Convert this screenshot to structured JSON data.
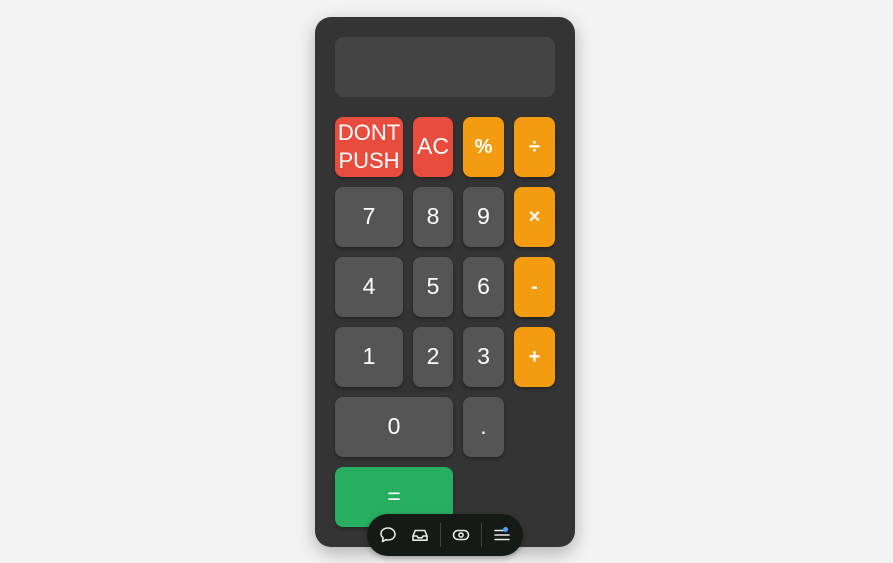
{
  "display": {
    "value": ""
  },
  "keys": {
    "dont_push": "DONT PUSH",
    "ac": "AC",
    "percent": "%",
    "divide": "÷",
    "seven": "7",
    "eight": "8",
    "nine": "9",
    "multiply": "×",
    "four": "4",
    "five": "5",
    "six": "6",
    "minus": "-",
    "one": "1",
    "two": "2",
    "three": "3",
    "plus": "+",
    "zero": "0",
    "decimal": ".",
    "equals": "="
  },
  "colors": {
    "background": "#f3f3f3",
    "body": "#343434",
    "display": "#444444",
    "number_key": "#555555",
    "danger_key": "#e74c3c",
    "operator_key": "#f39c12",
    "equals_key": "#27ae60",
    "dock": "#151a17",
    "notification": "#4ea3ff"
  },
  "dock": {
    "icons": [
      "chat-bubble-icon",
      "inbox-tray-icon",
      "eye-icon",
      "menu-icon"
    ]
  }
}
